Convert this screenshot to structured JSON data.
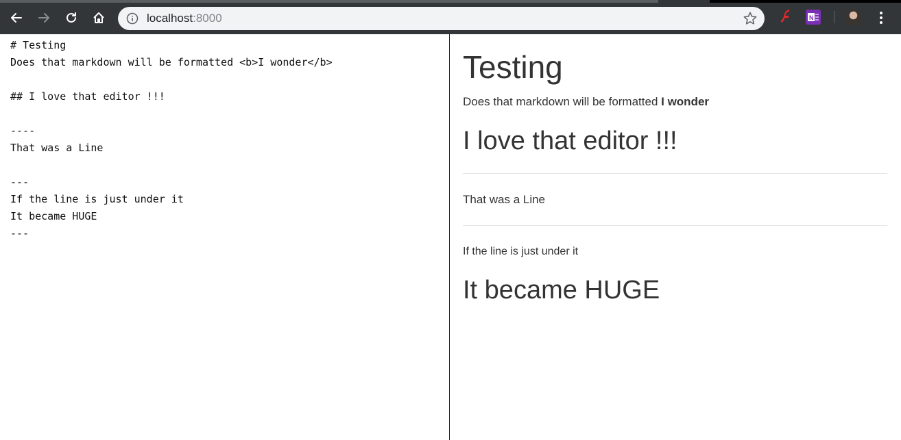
{
  "browser": {
    "url_host": "localhost",
    "url_port": ":8000"
  },
  "editor": {
    "source_lines": [
      "# Testing",
      "Does that markdown will be formatted <b>I wonder</b>",
      "",
      "## I love that editor !!!",
      "",
      "----",
      "That was a Line",
      "",
      "---",
      "If the line is just under it",
      "It became HUGE",
      "---"
    ]
  },
  "preview": {
    "heading1": "Testing",
    "paragraph1_text": "Does that markdown will be formatted ",
    "paragraph1_bold": "I wonder",
    "heading2": "I love that editor !!!",
    "paragraph2": "That was a Line",
    "paragraph3": "If the line is just under it",
    "heading3": "It became HUGE"
  }
}
